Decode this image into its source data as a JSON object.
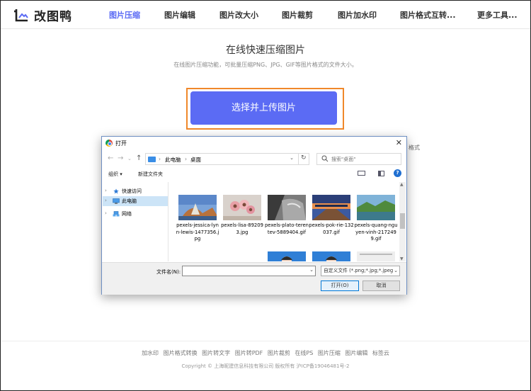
{
  "header": {
    "logo_text": "改图鸭",
    "nav": [
      {
        "label": "图片压缩",
        "active": true
      },
      {
        "label": "图片编辑"
      },
      {
        "label": "图片改大小"
      },
      {
        "label": "图片裁剪"
      },
      {
        "label": "图片加水印"
      },
      {
        "label": "图片格式互转..."
      },
      {
        "label": "更多工具..."
      }
    ]
  },
  "hero": {
    "title": "在线快速压缩图片",
    "subtitle": "在线图片压缩功能，可批量压缩PNG、JPG、GIF等图片格式的文件大小。",
    "upload_label": "选择并上传图片",
    "hint_partial": "格式"
  },
  "footer": {
    "links": [
      "加水印",
      "图片格式转换",
      "图片转文字",
      "图片转PDF",
      "图片裁剪",
      "在线PS",
      "图片压缩",
      "图片编辑",
      "标签云"
    ],
    "copyright": "Copyright © 上海昵建信息科技有限公司 版权所有 沪ICP备19046481号-2"
  },
  "dialog": {
    "title": "打开",
    "close": "✕",
    "path": [
      "此电脑",
      "桌面"
    ],
    "search_placeholder": "搜索\"桌面\"",
    "toolbar": {
      "organize": "组织 ▾",
      "new_folder": "新建文件夹",
      "help": "?"
    },
    "tree": [
      {
        "label": "快速访问",
        "selected": false
      },
      {
        "label": "此电脑",
        "selected": true
      },
      {
        "label": "网络",
        "selected": false
      }
    ],
    "files": [
      {
        "name": "pexels-jessica-lynn-lewis-1477356.jpg"
      },
      {
        "name": "pexels-lisa-892093.jpg"
      },
      {
        "name": "pexels-plato-terentev-5889404.gif"
      },
      {
        "name": "pexels-pok-rie-132037.gif"
      },
      {
        "name": "pexels-quang-nguyen-vinh-2172499.gif"
      }
    ],
    "filename_label": "文件名(N):",
    "filename_value": "",
    "filetype": "自定义文件 (*.png;*.jpg;*.jpeg",
    "open_label": "打开(O)",
    "cancel_label": "取消"
  },
  "colors": {
    "accent": "#5b6bf4",
    "highlight_border": "#f0882a"
  }
}
